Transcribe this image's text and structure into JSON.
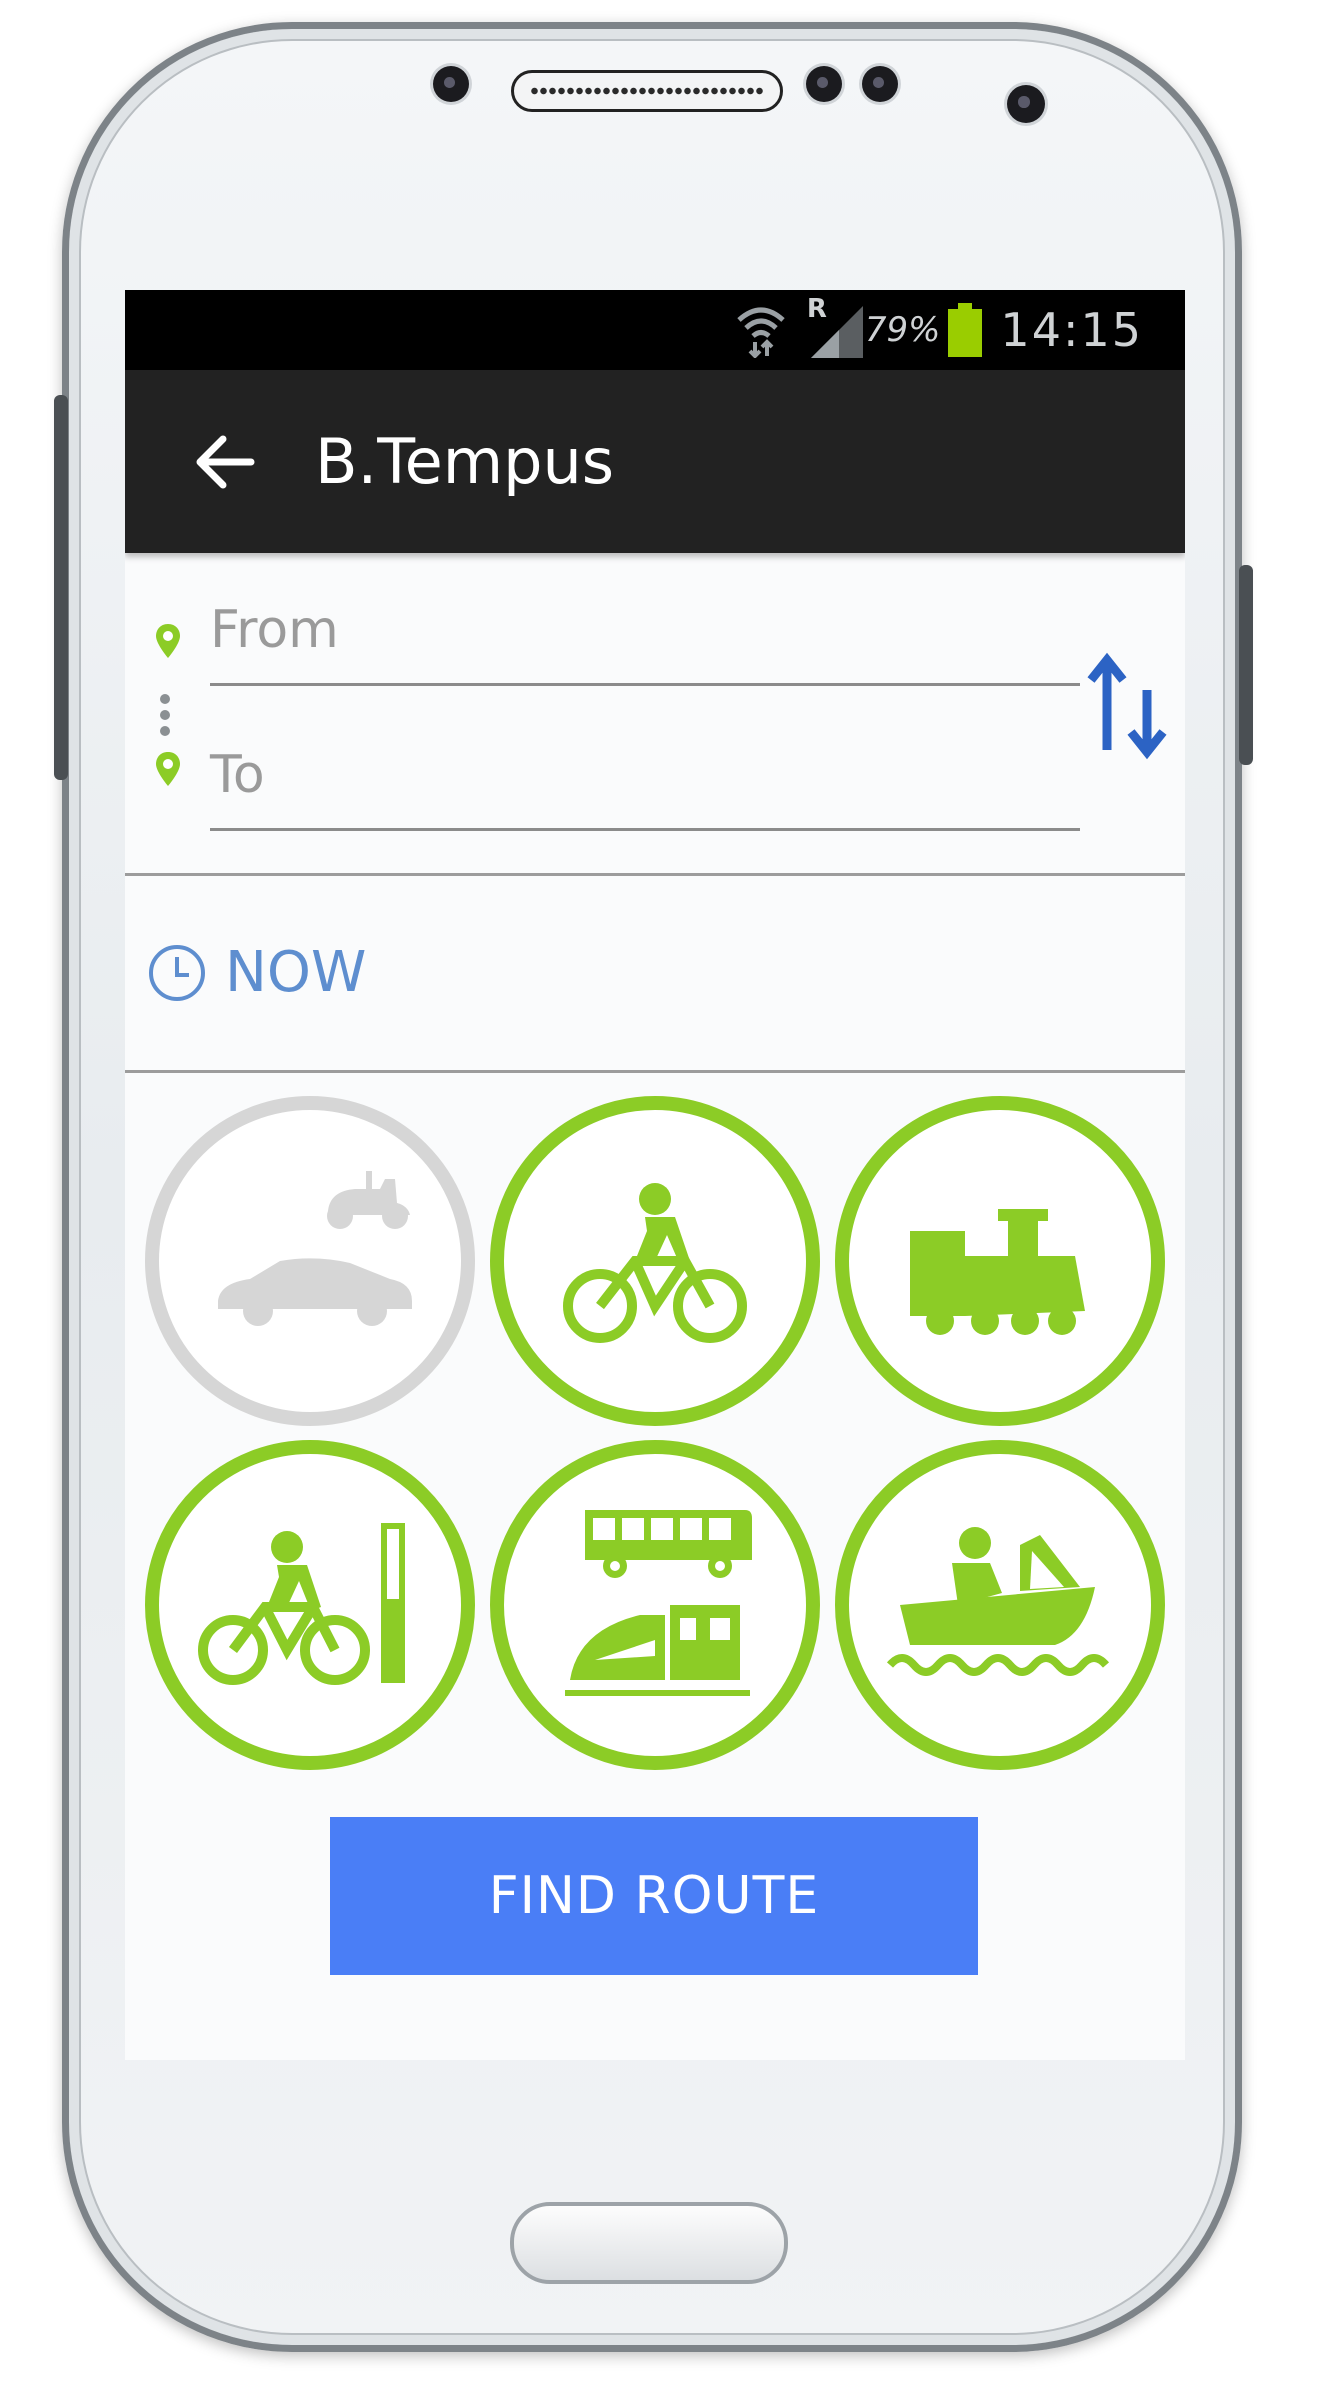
{
  "status_bar": {
    "roaming": "R",
    "battery_percent": "79%",
    "battery_color": "#9acd00",
    "time": "14:15",
    "icons": [
      "wifi-icon",
      "signal-icon",
      "battery-icon"
    ]
  },
  "app_bar": {
    "back_icon": "arrow-left-icon",
    "title": "B.Tempus"
  },
  "route_form": {
    "from_placeholder": "From",
    "to_placeholder": "To",
    "pin_icon": "location-pin-icon",
    "swap_icon": "swap-arrows-icon"
  },
  "departure": {
    "icon": "clock-icon",
    "label": "NOW"
  },
  "transport_modes": [
    {
      "name": "car-scooter",
      "icon": "car-scooter-icon",
      "selected": false
    },
    {
      "name": "bicycle",
      "icon": "bicycle-icon",
      "selected": true
    },
    {
      "name": "train",
      "icon": "train-icon",
      "selected": true
    },
    {
      "name": "bike-sharing",
      "icon": "bike-sharing-icon",
      "selected": true
    },
    {
      "name": "bus-rail",
      "icon": "bus-rail-icon",
      "selected": true
    },
    {
      "name": "boat",
      "icon": "boat-icon",
      "selected": true
    }
  ],
  "colors": {
    "accent_green": "#8ccc26",
    "disabled_gray": "#d6d6d6",
    "primary_blue": "#4a7ef6",
    "link_blue": "#5e8ecf",
    "swap_blue": "#2c63c4",
    "app_bar": "#222222"
  },
  "actions": {
    "find_route": "FIND ROUTE"
  }
}
